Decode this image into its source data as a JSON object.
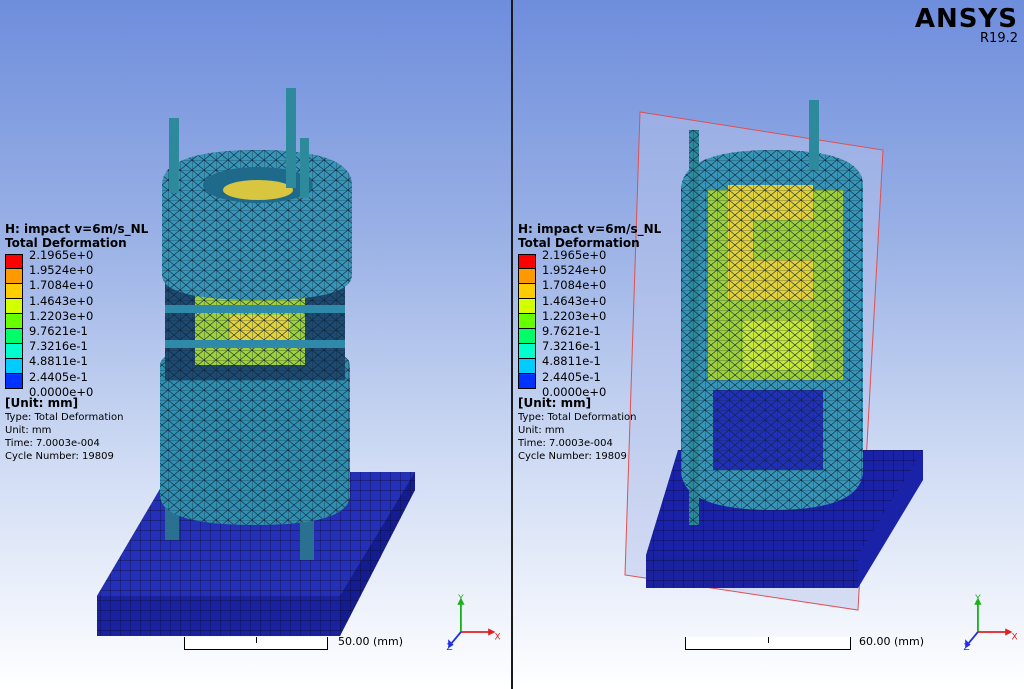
{
  "brand": {
    "name": "ANSYS",
    "version": "R19.2"
  },
  "views": [
    {
      "legend": {
        "title": "H: impact v=6m/s_NL",
        "subtitle": "Total Deformation",
        "levels": [
          "2.1965e+0",
          "1.9524e+0",
          "1.7084e+0",
          "1.4643e+0",
          "1.2203e+0",
          "9.7621e-1",
          "7.3216e-1",
          "4.8811e-1",
          "2.4405e-1",
          "0.0000e+0"
        ],
        "colors": [
          "#ff0000",
          "#ff9900",
          "#ffcc00",
          "#d4ff00",
          "#66ff00",
          "#00ff66",
          "#00ffcc",
          "#00ccff",
          "#0033ff"
        ],
        "unit": "[Unit: mm]",
        "type": "Type: Total Deformation",
        "unit_line": "Unit: mm",
        "time": "Time: 7.0003e-004",
        "cycle": "Cycle Number: 19809"
      },
      "scalebar": {
        "label": "50.00",
        "unit": "(mm)"
      },
      "triad": {
        "x": "X",
        "y": "Y",
        "z": "Z"
      }
    },
    {
      "legend": {
        "title": "H: impact v=6m/s_NL",
        "subtitle": "Total Deformation",
        "levels": [
          "2.1965e+0",
          "1.9524e+0",
          "1.7084e+0",
          "1.4643e+0",
          "1.2203e+0",
          "9.7621e-1",
          "7.3216e-1",
          "4.8811e-1",
          "2.4405e-1",
          "0.0000e+0"
        ],
        "colors": [
          "#ff0000",
          "#ff9900",
          "#ffcc00",
          "#d4ff00",
          "#66ff00",
          "#00ff66",
          "#00ffcc",
          "#00ccff",
          "#0033ff"
        ],
        "unit": "[Unit: mm]",
        "type": "Type: Total Deformation",
        "unit_line": "Unit: mm",
        "time": "Time: 7.0003e-004",
        "cycle": "Cycle Number: 19809"
      },
      "scalebar": {
        "label": "60.00",
        "unit": "(mm)"
      },
      "triad": {
        "x": "X",
        "y": "Y",
        "z": "Z"
      }
    }
  ]
}
